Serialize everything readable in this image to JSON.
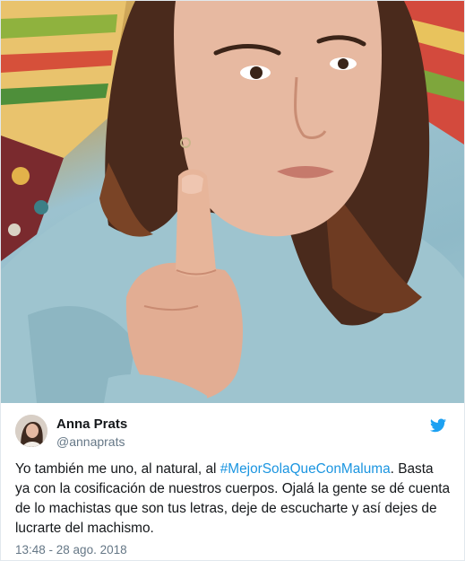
{
  "author": {
    "name": "Anna Prats",
    "handle": "@annaprats"
  },
  "tweet": {
    "text_before": "Yo también me uno, al natural, al ",
    "hashtag": "#MejorSolaQueConMaluma",
    "text_after": ". Basta ya con la cosificación de nuestros cuerpos. Ojalá la gente se dé cuenta de lo machistas que son tus letras, deje de escucharte y así dejes de lucrarte del machismo.",
    "timestamp": "13:48 - 28 ago. 2018"
  },
  "colors": {
    "hashtag": "#1b95e0",
    "twitter_blue": "#1da1f2",
    "secondary_text": "#657786"
  },
  "icons": {
    "brand": "twitter-bird-icon"
  }
}
